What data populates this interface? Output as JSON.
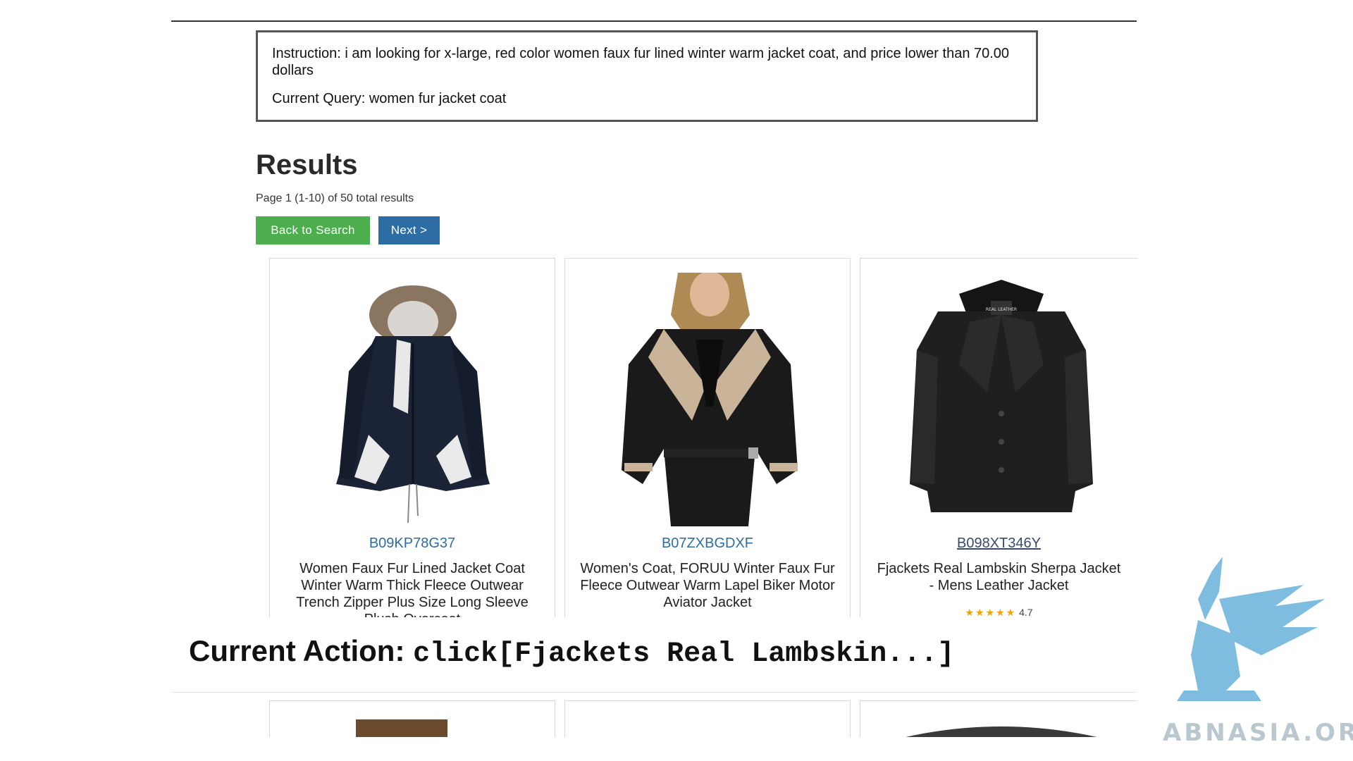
{
  "instruction": {
    "text": "Instruction: i am looking for x-large, red color women faux fur lined winter warm jacket coat, and price lower than 70.00 dollars",
    "query": "Current Query: women fur jacket coat"
  },
  "results": {
    "title": "Results",
    "page_info": "Page 1 (1-10) of 50 total results",
    "back_button": "Back to Search",
    "next_button": "Next >"
  },
  "products": [
    {
      "asin": "B09KP78G37",
      "title": "Women Faux Fur Lined Jacket Coat Winter Warm Thick Fleece Outwear Trench Zipper Plus Size Long Sleeve Plush Overcoat"
    },
    {
      "asin": "B07ZXBGDXF",
      "title": "Women's Coat, FORUU Winter Faux Fur Fleece Outwear Warm Lapel Biker Motor Aviator Jacket"
    },
    {
      "asin": "B098XT346Y",
      "title": "Fjackets Real Lambskin Sherpa Jacket - Mens Leather Jacket",
      "rating_stars": "★★★★★",
      "rating_value": "4.7"
    }
  ],
  "current_action": {
    "label": "Current Action:",
    "code": "click[Fjackets Real Lambskin...]"
  },
  "watermark": {
    "text": "ABNASIA.ORG",
    "color": "#7fbde0"
  },
  "logo_text": {
    "lettering": "REAL LEATHER"
  }
}
